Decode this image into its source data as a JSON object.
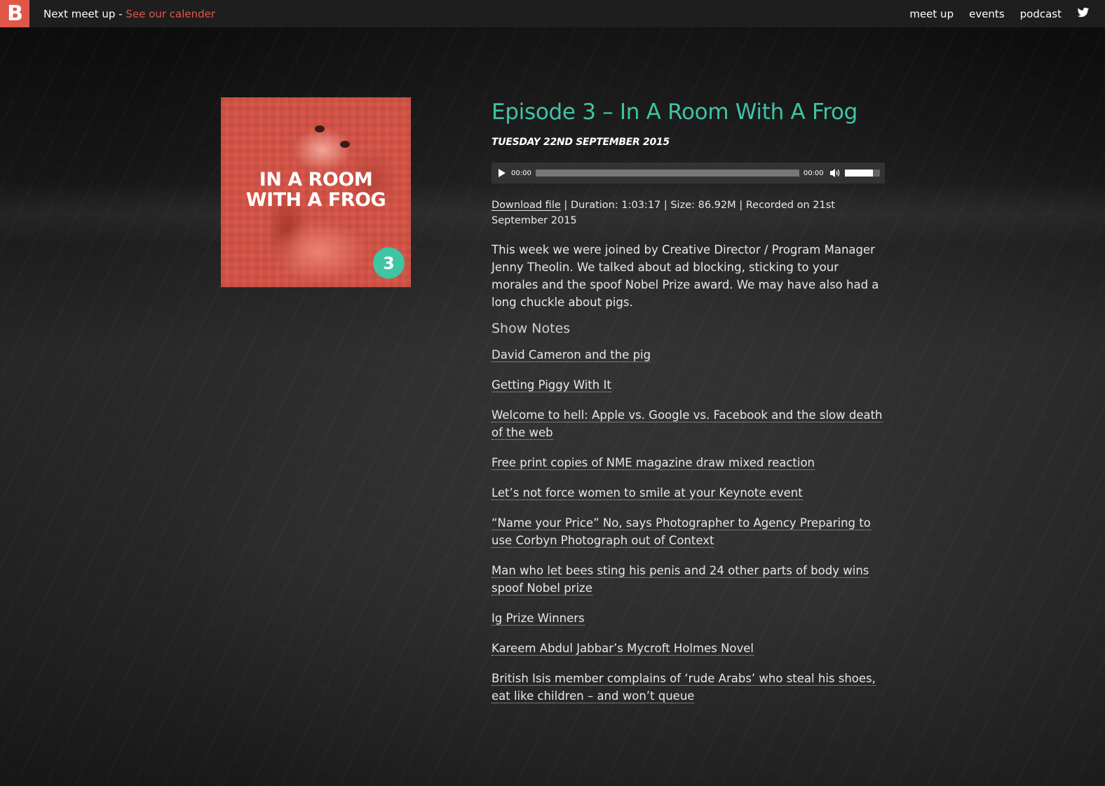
{
  "topbar": {
    "logo_letter": "B",
    "next_meetup_label": "Next meet up - ",
    "calendar_link": "See our calender",
    "nav": [
      {
        "label": "meet up"
      },
      {
        "label": "events"
      },
      {
        "label": "podcast"
      }
    ],
    "twitter_icon": "twitter-icon"
  },
  "cover": {
    "title": "IN A ROOM\nWITH A FROG",
    "episode_number": "3",
    "badge_color": "#3fc4a4",
    "art_color": "#d9574a"
  },
  "episode": {
    "title": "Episode 3 – In A Room With A Frog",
    "date": "TUESDAY 22ND SEPTEMBER 2015",
    "player": {
      "current_time": "00:00",
      "duration_time": "00:00",
      "volume": 0.8
    },
    "download_link": "Download file",
    "meta_text": " | Duration: 1:03:17 | Size: 86.92M | Recorded on 21st September 2015",
    "description": "This week we were joined by Creative Director / Program Manager Jenny Theolin. We talked about ad blocking, sticking to your morales and the spoof Nobel Prize award. We may have also had a long chuckle about pigs.",
    "show_notes_title": "Show Notes",
    "show_notes": [
      "David Cameron and the pig",
      "Getting Piggy With It",
      "Welcome to hell: Apple vs. Google vs. Facebook and the slow death of the web",
      "Free print copies of NME magazine draw mixed reaction",
      "Let’s not force women to smile at your Keynote event",
      "“Name your Price” No, says Photographer to Agency Preparing to use Corbyn Photograph out of Context",
      "Man who let bees sting his penis and 24 other parts of body wins spoof Nobel prize",
      "Ig Prize Winners",
      "Kareem Abdul Jabbar’s Mycroft Holmes Novel",
      "British Isis member complains of ‘rude Arabs’ who steal his shoes, eat like children – and won’t queue"
    ]
  },
  "colors": {
    "accent_teal": "#3fc4a4",
    "brand_red": "#e0574a",
    "topbar_bg": "#1e1e1e"
  }
}
